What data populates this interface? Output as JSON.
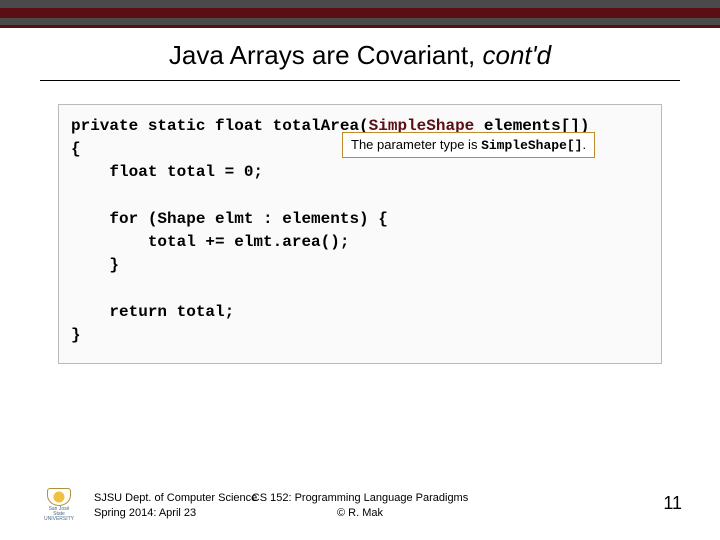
{
  "title_plain": "Java Arrays are Covariant, ",
  "title_italic": "cont'd",
  "code": {
    "l1a": "private static float totalArea(",
    "l1b": "SimpleShape",
    "l1c": " elements[])",
    "l2": "{",
    "l3": "    float total = 0;",
    "blank1": "",
    "l4": "    for (Shape elmt : elements) {",
    "l5": "        total += elmt.area();",
    "l6": "    }",
    "blank2": "",
    "l7": "    return total;",
    "l8": "}"
  },
  "annotation": {
    "prefix": "The parameter type is ",
    "type": "SimpleShape[]",
    "suffix": "."
  },
  "footer": {
    "left_line1": "SJSU Dept. of Computer Science",
    "left_line2": "Spring 2014: April 23",
    "center_line1": "CS 152: Programming Language Paradigms",
    "center_line2": "© R. Mak",
    "page": "11",
    "logo_text": "San José State UNIVERSITY"
  }
}
